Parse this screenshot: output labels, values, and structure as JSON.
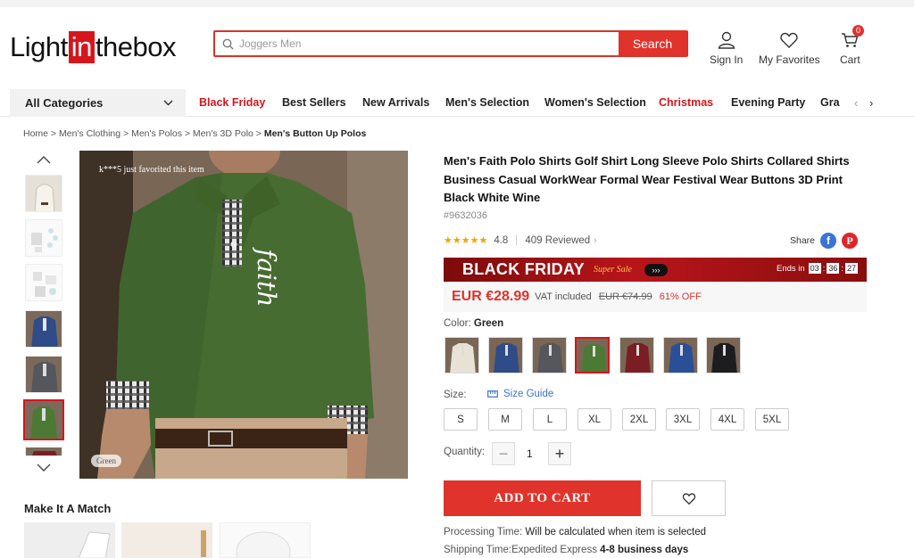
{
  "header": {
    "logo_left": "Light",
    "logo_mid": "in",
    "logo_right": "thebox",
    "search_placeholder": "Joggers Men",
    "search_button": "Search",
    "sign_in": "Sign In",
    "favorites": "My Favorites",
    "cart": "Cart",
    "cart_count": "0"
  },
  "nav": {
    "all_categories": "All Categories",
    "items": [
      {
        "label": "Black Friday",
        "highlight": true
      },
      {
        "label": "Best Sellers",
        "highlight": false
      },
      {
        "label": "New Arrivals",
        "highlight": false
      },
      {
        "label": "Men's Selection",
        "highlight": false
      },
      {
        "label": "Women's Selection",
        "highlight": false
      },
      {
        "label": "Christmas",
        "highlight": true
      },
      {
        "label": "Evening Party",
        "highlight": false
      },
      {
        "label": "Graduation",
        "highlight": false
      }
    ]
  },
  "breadcrumb": {
    "items": [
      "Home",
      "Men's Clothing",
      "Men's Polos",
      "Men's 3D Polo"
    ],
    "current": "Men's Button Up Polos"
  },
  "gallery": {
    "favorited_note": "k***5 just favorited this item",
    "image_tag": "Green",
    "print_text": "faith"
  },
  "make_match": {
    "title": "Make It A Match"
  },
  "product": {
    "title": "Men's Faith Polo Shirts Golf Shirt Long Sleeve Polo Shirts Collared Shirts Business Casual WorkWear Formal Wear Festival Wear Buttons 3D Print Black White Wine",
    "id": "#9632036",
    "rating": "4.8",
    "stars": 5,
    "reviews": "409 Reviewed",
    "share": "Share"
  },
  "promo": {
    "title": "BLACK FRIDAY",
    "subtitle": "Super Sale",
    "ends_label": "Ends in",
    "hours": "03",
    "minutes": "36",
    "seconds": "27"
  },
  "price": {
    "current": "EUR €28.99",
    "vat": "VAT included",
    "original": "EUR €74.99",
    "discount": "61% OFF"
  },
  "color": {
    "label": "Color:",
    "selected": "Green",
    "swatches": [
      "#e8e2d6",
      "#2f4c88",
      "#55575c",
      "#4c7a35",
      "#7a1e24",
      "#2a4f96",
      "#1d1d1f"
    ]
  },
  "size": {
    "label": "Size:",
    "guide": "Size Guide",
    "options": [
      "S",
      "M",
      "L",
      "XL",
      "2XL",
      "3XL",
      "4XL",
      "5XL"
    ]
  },
  "quantity": {
    "label": "Quantity:",
    "value": "1"
  },
  "actions": {
    "add_to_cart": "ADD TO CART"
  },
  "shipping": {
    "processing_label": "Processing Time:",
    "processing_value": "Will be calculated when item is selected",
    "shipping_label": "Shipping Time:Expedited Express",
    "shipping_value": "4-8 business days"
  },
  "colors": {
    "accent": "#e0332b",
    "brand": "#d6161c",
    "link": "#3a73c8"
  }
}
